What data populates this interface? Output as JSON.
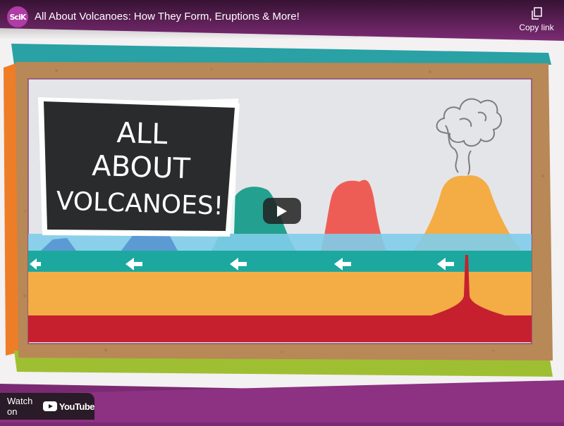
{
  "header": {
    "channel_logo_text": "SciK",
    "title": "All About Volcanoes: How They Form, Eruptions & More!",
    "copy_link_label": "Copy link",
    "copy_icon": "copy-icon"
  },
  "video": {
    "chalkboard_lines": [
      "ALL",
      "ABOUT",
      "VOLCANOES!"
    ],
    "play_icon": "play-icon",
    "colors": {
      "background": "#7a2a72",
      "teal": "#2aa5a0",
      "orange": "#f4ac45",
      "red": "#c6202e",
      "cardboard": "#b98857",
      "sky": "#e4e5e8",
      "water": "#80cdea"
    }
  },
  "footer": {
    "watch_on_label": "Watch on",
    "youtube_label": "YouTube",
    "youtube_icon": "youtube-icon"
  }
}
